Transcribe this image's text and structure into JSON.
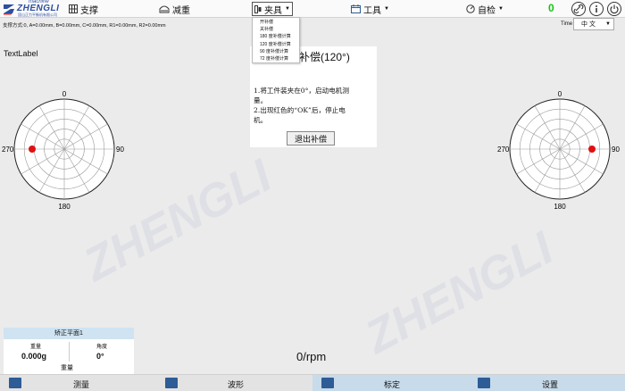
{
  "header": {
    "logo": {
      "machine": "machine",
      "word": "ZHENGLI",
      "sub": "昆山正力平衡机有限公司"
    },
    "nav": [
      {
        "label": "支撑",
        "icon": "support-grid-icon"
      },
      {
        "label": "减重",
        "icon": "weight-icon"
      },
      {
        "label": "夹具",
        "icon": "fixture-icon"
      },
      {
        "label": "工具",
        "icon": "calendar-tool-icon"
      },
      {
        "label": "自检",
        "icon": "self-check-icon"
      }
    ],
    "counter": "0",
    "icons": [
      "link-icon",
      "info-icon",
      "power-icon"
    ]
  },
  "fixture_menu": {
    "items": [
      "开补偿",
      "关补偿",
      "180 度补偿计算",
      "120 度补偿计算",
      "90 度补偿计算",
      "72 度补偿计算"
    ]
  },
  "status_line": "支撑方式:0,  A=0.00mm,  B=0.00mm,  C=0.00mm,  R1=0.00mm,  R2=0.00mm",
  "time": {
    "label": "Time",
    "lang": "中 文"
  },
  "text_label": "TextLabel",
  "dialog": {
    "title": "补偿(120°)",
    "line1a": "1.将工件装夹在0°，启动电机测",
    "line1b": "量。",
    "line2a": "2.出现红色的“OK”后，停止电",
    "line2b": "机。",
    "exit_button": "退出补偿"
  },
  "polar_left": {
    "top": "0",
    "right": "90",
    "bottom": "180",
    "left": "270",
    "marker_angle": 270
  },
  "polar_right": {
    "top": "0",
    "right": "90",
    "bottom": "180",
    "left": "270",
    "marker_angle": 90
  },
  "calibration": {
    "header": "矫正平面1",
    "weight_label": "重量",
    "angle_label": "角度",
    "weight_value": "0.000g",
    "angle_value": "0°",
    "footer": "重量"
  },
  "rpm": "0/rpm",
  "bottom_nav": [
    {
      "label": "测量",
      "icon": "measure-icon"
    },
    {
      "label": "波形",
      "icon": "wave-icon"
    },
    {
      "label": "标定",
      "icon": "calibrate-icon"
    },
    {
      "label": "设置",
      "icon": "settings-icon"
    }
  ],
  "colors": {
    "brand_blue": "#2d4fa0",
    "marker_red": "#e01010",
    "counter_green": "#17c317",
    "selected_tab": "#c7dbea"
  }
}
